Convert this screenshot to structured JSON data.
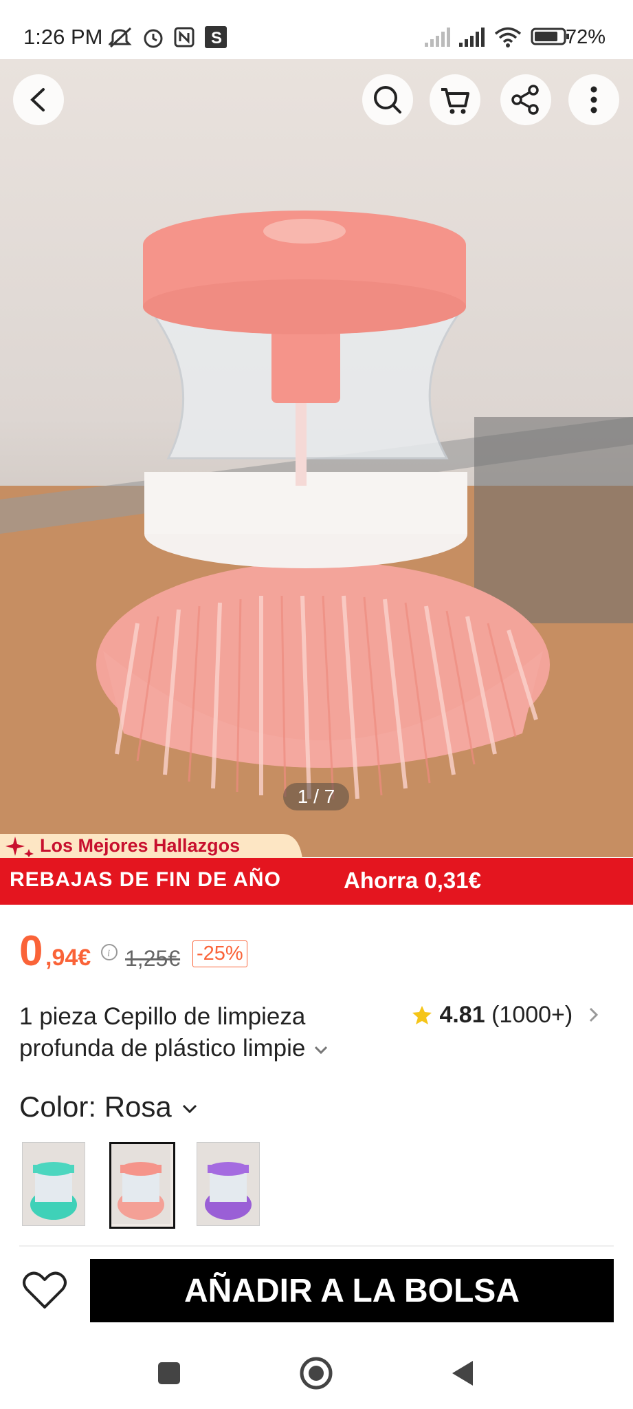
{
  "status_bar": {
    "time": "1:26 PM",
    "battery": "72%",
    "icons": [
      "mute-icon",
      "alarm-icon",
      "nfc-icon",
      "app-s-icon",
      "signal-icon",
      "signal-icon",
      "wifi-icon",
      "battery-icon"
    ]
  },
  "gallery": {
    "counter": "1 / 7",
    "icons": [
      "back-icon",
      "search-icon",
      "cart-icon",
      "share-icon",
      "more-icon"
    ]
  },
  "promo": {
    "badge": "Los Mejores Hallazgos",
    "sale": "REBAJAS DE FIN DE AÑO",
    "saving": "Ahorra 0,31€"
  },
  "price": {
    "integer": "0",
    "decimal": ",94€",
    "original": "1,25€",
    "discount": "-25%"
  },
  "product": {
    "title_line1": "1 pieza Cepillo de limpieza",
    "title_line2": "profunda de plástico limpie",
    "rating": "4.81",
    "reviews": "(1000+)"
  },
  "color": {
    "label": "Color: Rosa",
    "options": [
      "Verde",
      "Rosa",
      "Morado"
    ],
    "selected": "Rosa"
  },
  "actions": {
    "add_to_bag": "AÑADIR A LA BOLSA"
  },
  "colors": {
    "accent": "#fa6338",
    "promo_red": "#e4151f",
    "star": "#f5c518"
  }
}
